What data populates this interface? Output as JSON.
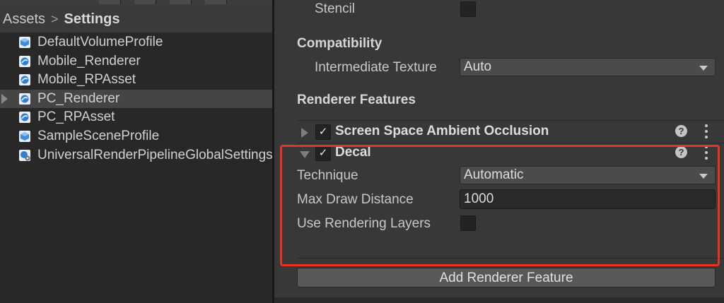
{
  "breadcrumb": {
    "root": "Assets",
    "separator": ">",
    "current": "Settings"
  },
  "tree": {
    "items": [
      {
        "label": "DefaultVolumeProfile",
        "icon": "volume-profile-icon",
        "selected": false
      },
      {
        "label": "Mobile_Renderer",
        "icon": "renderer-asset-icon",
        "selected": false
      },
      {
        "label": "Mobile_RPAsset",
        "icon": "renderer-asset-icon",
        "selected": false
      },
      {
        "label": "PC_Renderer",
        "icon": "renderer-asset-icon",
        "selected": true
      },
      {
        "label": "PC_RPAsset",
        "icon": "renderer-asset-icon",
        "selected": false
      },
      {
        "label": "SampleSceneProfile",
        "icon": "volume-profile-icon",
        "selected": false
      },
      {
        "label": "UniversalRenderPipelineGlobalSettings",
        "icon": "global-settings-icon",
        "selected": false
      }
    ]
  },
  "inspector": {
    "stencil_label": "Stencil",
    "compatibility_header": "Compatibility",
    "intermediate_texture_label": "Intermediate Texture",
    "intermediate_texture_value": "Auto",
    "renderer_features_header": "Renderer Features",
    "features": [
      {
        "name": "Screen Space Ambient Occlusion",
        "enabled": true,
        "expanded": false
      },
      {
        "name": "Decal",
        "enabled": true,
        "expanded": true
      }
    ],
    "decal": {
      "technique_label": "Technique",
      "technique_value": "Automatic",
      "max_draw_distance_label": "Max Draw Distance",
      "max_draw_distance_value": "1000",
      "use_rendering_layers_label": "Use Rendering Layers"
    },
    "checkmark": "✓",
    "help_glyph": "?",
    "add_button_label": "Add Renderer Feature"
  },
  "colors": {
    "highlight_border": "#e8321d",
    "panel_bg": "#383838",
    "project_bg": "#282828"
  }
}
